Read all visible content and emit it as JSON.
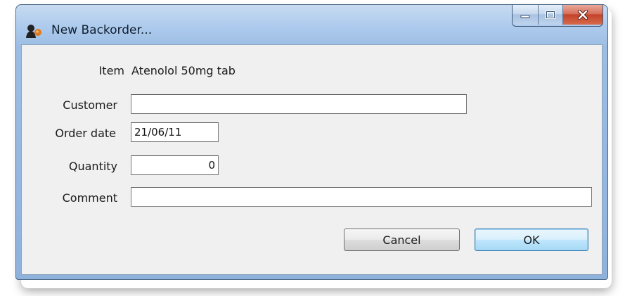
{
  "window": {
    "title": "New Backorder...",
    "controls": {
      "minimize_icon": "minimize-icon",
      "maximize_icon": "maximize-icon",
      "close_icon": "close-icon"
    },
    "colors": {
      "title_bar": "#aecbed",
      "client": "#f0f0f0",
      "close": "#c3432a"
    }
  },
  "form": {
    "item": {
      "label": "Item",
      "value": "Atenolol 50mg tab"
    },
    "customer": {
      "label": "Customer",
      "value": ""
    },
    "order_date": {
      "label": "Order date",
      "value": "21/06/11"
    },
    "quantity": {
      "label": "Quantity",
      "value": "0"
    },
    "comment": {
      "label": "Comment",
      "value": ""
    }
  },
  "buttons": {
    "cancel": "Cancel",
    "ok": "OK"
  }
}
